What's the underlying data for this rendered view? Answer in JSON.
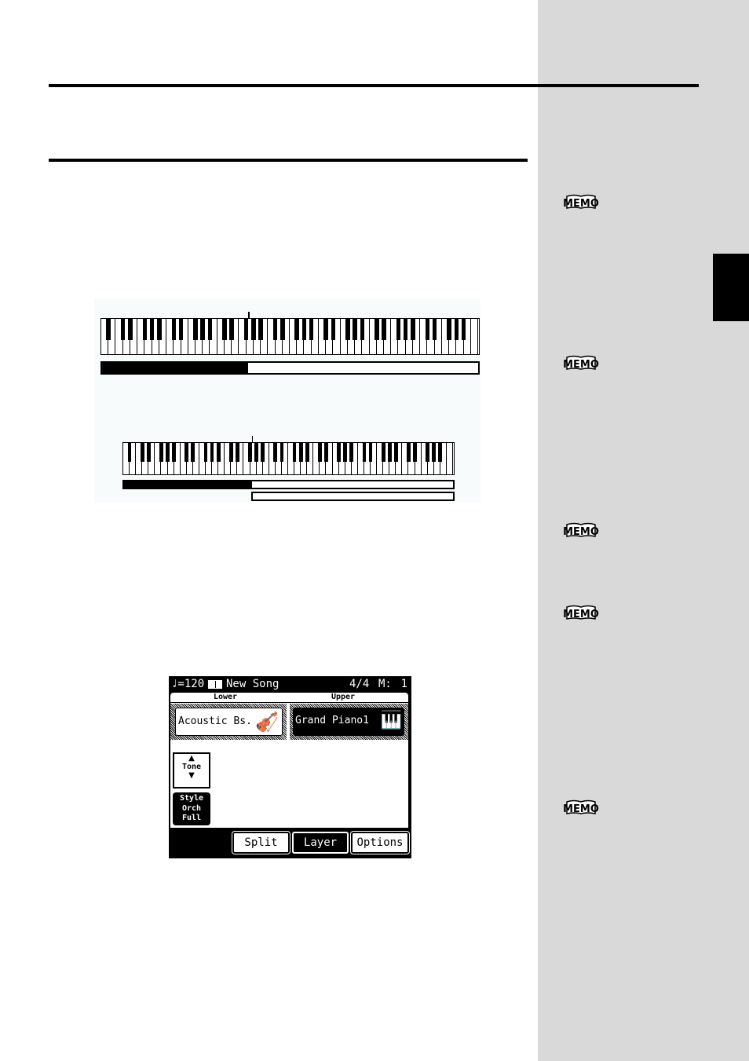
{
  "page": {
    "accent": "#000000",
    "sidebar_color": "#d9d9d9"
  },
  "memo": {
    "label": "MEMO",
    "count": 5
  },
  "keyboards": [
    {
      "keys": 88,
      "split_fraction": 0.39,
      "bars": [
        {
          "lower_fill": true
        }
      ]
    },
    {
      "keys": 88,
      "split_fraction": 0.39,
      "bars": [
        {
          "lower_fill": true
        },
        {
          "upper_only": true
        }
      ]
    }
  ],
  "lcd": {
    "tempo": "♩=120",
    "song_icon": "book-icon",
    "song_name": "New Song",
    "time_signature": "4/4",
    "measure_label": "M:",
    "measure_value": "1",
    "lower_label": "Lower",
    "upper_label": "Upper",
    "lower_tone": "Acoustic Bs.",
    "upper_tone": "Grand Piano1",
    "tone_button": "Tone",
    "style_lines": [
      "Style",
      "Orch",
      "Full"
    ],
    "buttons": [
      "Split",
      "Layer",
      "Options"
    ],
    "selected_button": "Layer"
  }
}
